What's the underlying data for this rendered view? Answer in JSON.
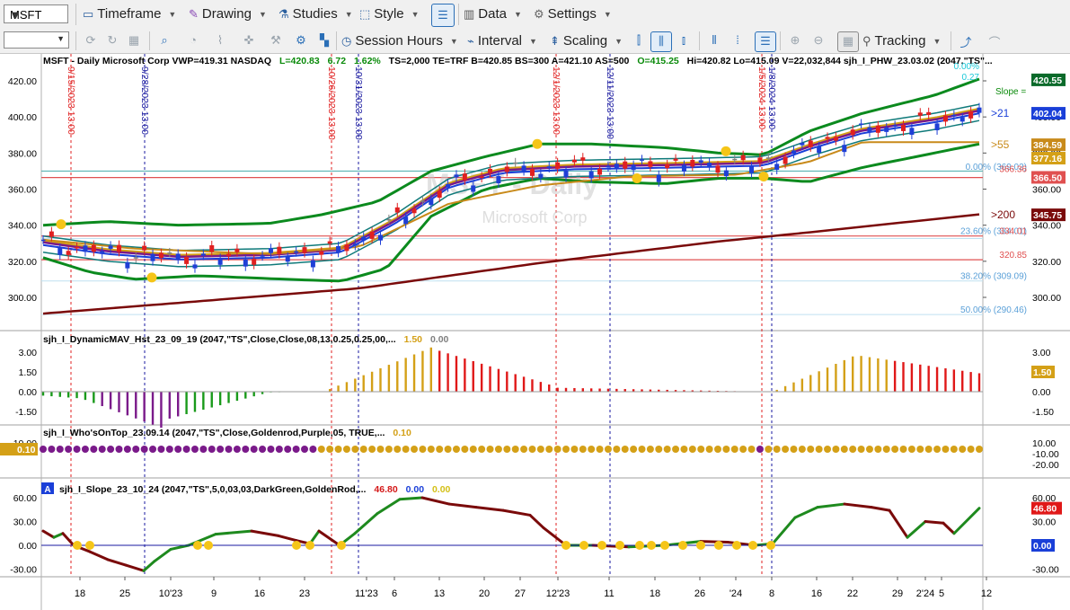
{
  "toolbar": {
    "symbol": "MSFT",
    "timeframe": "Timeframe",
    "drawing": "Drawing",
    "studies": "Studies",
    "style": "Style",
    "data": "Data",
    "settings": "Settings",
    "session_hours": "Session Hours",
    "interval": "Interval",
    "scaling": "Scaling",
    "tracking": "Tracking"
  },
  "chart": {
    "header": {
      "text1": "MSFT - Daily  Microsoft Corp  VWP=419.31  NASDAQ",
      "last": "L=420.83",
      "chg": "6.72",
      "pct": "1.62%",
      "text2": "TS=2,000  TE=TRF  B=420.85  BS=300  A=421.10  AS=500",
      "open": "O=415.25",
      "text3": "Hi=420.82  Lo=415.09  V=22,032,844  sjh_I_PHW_23.03.02 (2047,\"TS\"..."
    },
    "watermark_symbol": "MSFT - Daily",
    "watermark_name": "Microsoft Corp",
    "slope_label": "Slope =",
    "top_small_1": "0.00%",
    "top_small_2": "0.27",
    "date_labels": [
      "9/15/2023 13:00",
      "9/28/2023 13:00",
      "10/26/2023 13:00",
      "10/31/2023 13:00",
      "12/1/2023 13:00",
      "12/11/2023 13:00",
      "1/5/2024 13:00",
      "1/8/2024 13:00"
    ],
    "price_ticks": [
      "420.00",
      "400.00",
      "380.00",
      "360.00",
      "340.00",
      "320.00",
      "300.00"
    ],
    "right_ticks": [
      "420.00",
      "400.00",
      "380.00",
      "360.00",
      "340.00",
      "320.00",
      "300.00"
    ],
    "price_badges": {
      "last": "420.55",
      "b402": "402.04",
      "b384": "384.59",
      "b377": "377.16",
      "b366": "366.50",
      "b345": "345.75"
    },
    "ma_labels": {
      "m21": ">21",
      "m55": ">55",
      "m200": ">200"
    },
    "fib_labels": [
      "0.00% (369.02)",
      "23.60% (334.01)",
      "38.20% (309.09)",
      "50.00% (290.46)"
    ],
    "level_labels": [
      "366.36",
      "334.01",
      "320.85"
    ],
    "x_axis": [
      "18",
      "25",
      "10'23",
      "9",
      "16",
      "23",
      "11'23",
      "6",
      "13",
      "20",
      "27",
      "12'23",
      "11",
      "18",
      "26",
      "'24",
      "8",
      "16",
      "22",
      "29",
      "2'24",
      "5",
      "12"
    ]
  },
  "study1": {
    "title": "sjh_I_DynamicMAV_Hst_23_09_19 (2047,\"TS\",Close,Close,08,13,0.25,0.25,00,...",
    "v1": "1.50",
    "v2": "0.00",
    "ticks": [
      "3.00",
      "1.50",
      "0.00",
      "-1.50"
    ],
    "badge": "1.50"
  },
  "study2": {
    "title": "sjh_I_Who'sOnTop_23.09.14 (2047,\"TS\",Close,Goldenrod,Purple,05,  TRUE,...",
    "v1": "0.10",
    "ticks": [
      "10.00",
      "-10.00",
      "-20.00"
    ],
    "left_badge": "0.10"
  },
  "study3": {
    "marker": "A",
    "title": "sjh_I_Slope_23_10_24 (2047,\"TS\",5,0,03,03,DarkGreen,GoldenRod,...",
    "v1": "46.80",
    "v2": "0.00",
    "v3": "0.00",
    "ticks": [
      "60.00",
      "30.00",
      "0.00",
      "-30.00"
    ],
    "badge1": "46.80",
    "badge2": "0.00"
  },
  "colors": {
    "up_bar": "#1f3fd6",
    "down_bar": "#e02020",
    "flat_bar": "#808080",
    "bollinger": "#0b8a1e",
    "ma200": "#7a0a0a",
    "goldenrod": "#d4a017",
    "purple": "#7a1a8a",
    "hist_red": "#e01818",
    "hist_green": "#199a1a"
  }
}
